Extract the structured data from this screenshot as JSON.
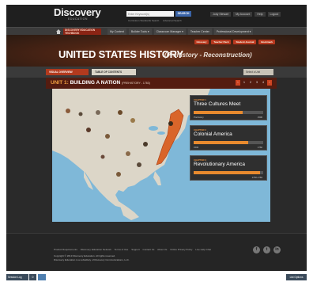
{
  "header": {
    "logo": "Discovery",
    "logo_sub": "EDUCATION",
    "search_placeholder": "Enter Keyword(s)",
    "search_button": "SEARCH",
    "sublinks": [
      "Curriculum Standards Search",
      "Advanced Search"
    ],
    "user_links": [
      "Jody Stewart",
      "My Account",
      "Help",
      "Logout"
    ]
  },
  "nav": {
    "brand": "DISCOVERY EDUCATION TECHBOOK",
    "items": [
      "My Content",
      "Builder Tools ▾",
      "Classroom Manager ▾",
      "Teacher Center",
      "Professional Development ▾"
    ]
  },
  "hero": {
    "actions": [
      "Glossary",
      "Teacher Pack",
      "Student Journal",
      "Bookmark"
    ],
    "title": "UNITED STATES HISTORY",
    "subtitle": "(Prehistory - Reconstruction)"
  },
  "tabs": {
    "active": "VISUAL OVERVIEW",
    "other": "TABLE OF CONTENTS",
    "unit_select": "Select a Unit"
  },
  "unit": {
    "num": "UNIT 1:",
    "title": "BUILDING A NATION",
    "range": "(PREHISTORY - 1783)",
    "pages": [
      "1",
      "2",
      "3",
      "4"
    ]
  },
  "chapters": [
    {
      "label": "CHAPTER 1",
      "name": "Three Cultures Meet",
      "from": "Prehistory",
      "to": "1500",
      "progress": 0.7
    },
    {
      "label": "CHAPTER 2",
      "name": "Colonial America",
      "from": "1500",
      "to": "1760",
      "progress": 0.78
    },
    {
      "label": "CHAPTER 3",
      "name": "Revolutionary America",
      "from": "",
      "to": "1760-1783",
      "progress": 0.95
    }
  ],
  "footer": {
    "links": [
      "Product Requirements",
      "Discovery Education Network",
      "Terms of Use",
      "Support",
      "Contact Us",
      "About Us",
      "Online Privacy Policy",
      "Live Help Chat"
    ],
    "copy1": "Copyright © 2013 Discovery Education. All rights reserved.",
    "copy2": "Discovery Education is a subsidiary of Discovery Communications, LLC.",
    "social": [
      "f",
      "t",
      "in"
    ]
  },
  "statusbar": {
    "left": "Session Log",
    "num": "0",
    "right": "List Options"
  },
  "colors": {
    "accent": "#b23a1e",
    "bar": "#e88a2e",
    "ocean": "#7fb8d8",
    "land": "#dcd6c8"
  }
}
